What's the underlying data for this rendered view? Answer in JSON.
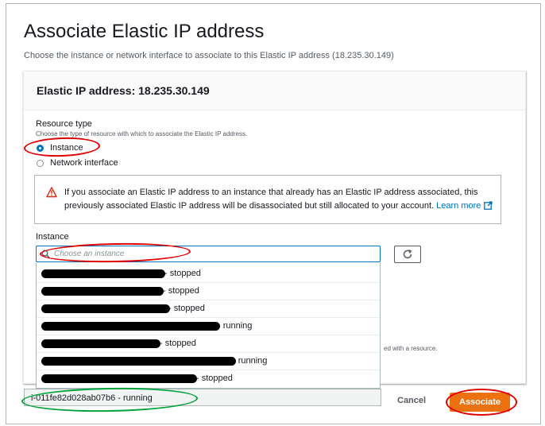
{
  "page": {
    "title": "Associate Elastic IP address",
    "subtitle": "Choose the instance or network interface to associate to this Elastic IP address (18.235.30.149)"
  },
  "panel": {
    "title": "Elastic IP address: 18.235.30.149",
    "resource_type_label": "Resource type",
    "resource_type_desc": "Choose the type of resource with which to associate the Elastic IP address.",
    "options": [
      {
        "label": "Instance",
        "checked": true
      },
      {
        "label": "Network interface",
        "checked": false
      }
    ],
    "alert": {
      "icon": "warning-icon",
      "text": "If you associate an Elastic IP address to an instance that already has an Elastic IP address associated, this previously associated Elastic IP address will be disassociated but still allocated to your account.",
      "link": "Learn more"
    },
    "instance_label": "Instance",
    "search_placeholder": "Choose an instance",
    "dropdown_items": [
      {
        "suffix": "- stopped"
      },
      {
        "suffix": "- stopped"
      },
      {
        "suffix": "- stopped"
      },
      {
        "suffix": "- running"
      },
      {
        "suffix": "- stopped"
      },
      {
        "suffix": "- running"
      },
      {
        "suffix": "- stopped"
      }
    ],
    "hidden_text": "ed with a resource.",
    "selected_item": "i-011fe82d028ab07b6 - running"
  },
  "footer": {
    "cancel_label": "Cancel",
    "associate_label": "Associate"
  },
  "colors": {
    "primary": "#ec7211",
    "link": "#0073bb",
    "annotation_red": "#e00000",
    "annotation_green": "#00a33a"
  }
}
